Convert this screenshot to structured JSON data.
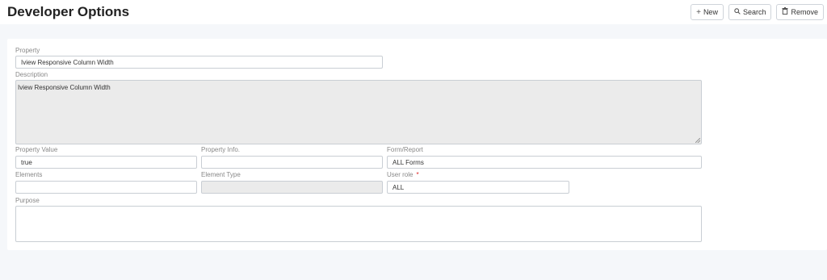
{
  "header": {
    "title": "Developer Options",
    "buttons": [
      {
        "label": "New",
        "icon": "plus-icon"
      },
      {
        "label": "Search",
        "icon": "search-icon"
      },
      {
        "label": "Remove",
        "icon": "trash-icon"
      }
    ]
  },
  "form": {
    "property": {
      "label": "Property",
      "value": "Iview Responsive Column Width"
    },
    "description": {
      "label": "Description",
      "value": "Iview Responsive Column Width"
    },
    "property_value": {
      "label": "Property Value",
      "value": "true"
    },
    "property_info": {
      "label": "Property Info.",
      "value": ""
    },
    "form_report": {
      "label": "Form/Report",
      "value": "ALL Forms"
    },
    "elements": {
      "label": "Elements",
      "value": ""
    },
    "element_type": {
      "label": "Element Type",
      "value": ""
    },
    "user_role": {
      "label": "User role",
      "required_mark": "*",
      "value": "ALL"
    },
    "purpose": {
      "label": "Purpose",
      "value": ""
    }
  },
  "colors": {
    "required": "#dd2222",
    "disabled_bg": "#ebebeb",
    "page_bg": "#f5f7fa"
  }
}
